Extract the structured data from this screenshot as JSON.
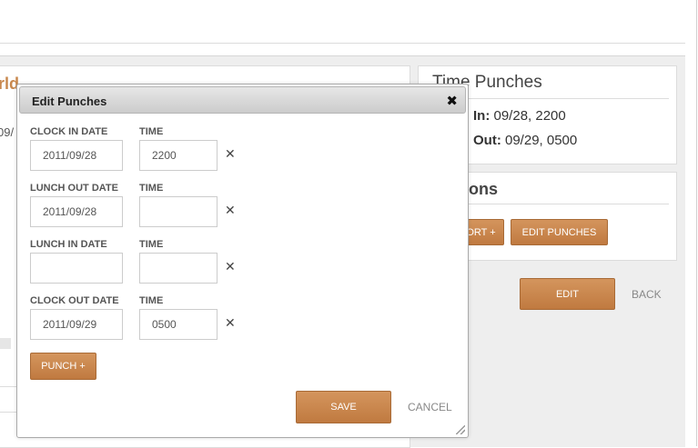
{
  "background": {
    "left_panel_title": "rld",
    "left_panel_date": "09/",
    "time_punches": {
      "title": "Time Punches",
      "in_label": "In:",
      "in_value": "09/28, 2200",
      "out_label": "Out:",
      "out_value": "09/29, 0500"
    },
    "actions": {
      "title": "ons",
      "report_label": "ORT +",
      "edit_punches_label": "EDIT PUNCHES"
    },
    "edit_label": "EDIT",
    "back_label": "BACK"
  },
  "modal": {
    "title": "Edit Punches",
    "close_glyph": "✖",
    "rows": [
      {
        "date_label": "CLOCK IN DATE",
        "time_label": "TIME",
        "date_value": "2011/09/28",
        "time_value": "2200"
      },
      {
        "date_label": "LUNCH OUT DATE",
        "time_label": "TIME",
        "date_value": "2011/09/28",
        "time_value": ""
      },
      {
        "date_label": "LUNCH IN DATE",
        "time_label": "TIME",
        "date_value": "",
        "time_value": ""
      },
      {
        "date_label": "CLOCK OUT DATE",
        "time_label": "TIME",
        "date_value": "2011/09/29",
        "time_value": "0500"
      }
    ],
    "clear_glyph": "✕",
    "punch_label": "PUNCH +",
    "save_label": "SAVE",
    "cancel_label": "CANCEL"
  },
  "colors": {
    "accent": "#c8884e",
    "button_top": "#d4955d",
    "button_bottom": "#c07a40"
  }
}
